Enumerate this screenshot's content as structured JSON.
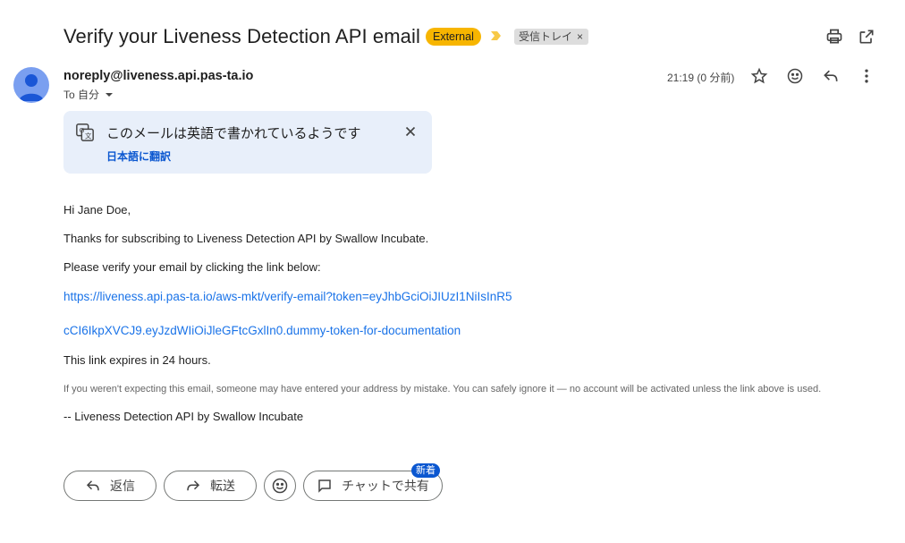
{
  "subject": "Verify your Liveness Detection API email",
  "external_badge": "External",
  "label_chip": "受信トレイ",
  "label_chip_remove": "×",
  "sender": "noreply@liveness.api.pas-ta.io",
  "to_line": "To 自分",
  "time": "21:19 (0 分前)",
  "translate": {
    "message": "このメールは英語で書かれているようです",
    "link": "日本語に翻訳"
  },
  "body": {
    "greeting": "Hi Jane Doe,",
    "line1": "Thanks for subscribing to Liveness Detection API by Swallow Incubate.",
    "line2": "Please verify your email by clicking the link below:",
    "link_part1": "https://liveness.api.pas-ta.io/aws-mkt/verify-email?token=eyJhbGciOiJIUzI1NiIsInR5",
    "link_part2": "cCI6IkpXVCJ9.eyJzdWIiOiJleGFtcGxlIn0.dummy-token-for-documentation",
    "expiry": "This link expires in 24 hours.",
    "disclaimer": "If you weren't expecting this email, someone may have entered your address by mistake. You can safely ignore it — no account will be activated unless the link above is used.",
    "signature": "-- Liveness Detection API by Swallow Incubate"
  },
  "actions": {
    "reply": "返信",
    "forward": "転送",
    "chat_share": "チャットで共有",
    "new_badge": "新着"
  },
  "icons": {
    "print": "print-icon",
    "open_new": "open-in-new-icon",
    "star": "star-icon",
    "emoji": "emoji-icon",
    "reply": "reply-icon",
    "more": "more-vert-icon",
    "translate": "translate-icon",
    "close": "close-icon"
  },
  "colors": {
    "external_badge": "#f7b500",
    "link": "#1a73e8",
    "translate_bg": "#e8effa",
    "new_badge": "#0b57d0",
    "avatar": "#7a9ff0"
  }
}
